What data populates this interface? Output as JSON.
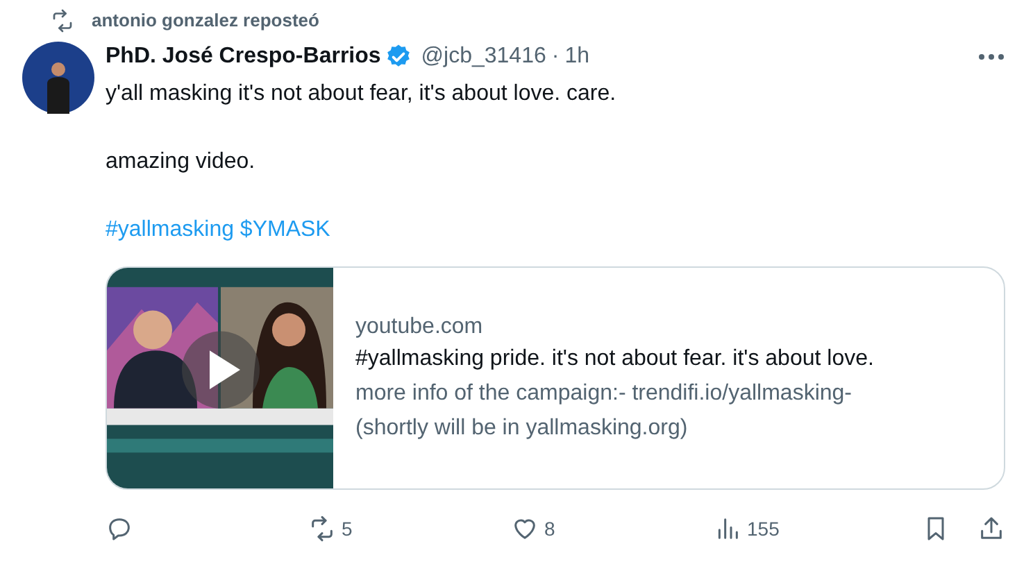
{
  "repost": {
    "label": "antonio gonzalez reposteó"
  },
  "author": {
    "name": "PhD. José Crespo-Barrios",
    "verified": true,
    "handle": "@jcb_31416",
    "separator": "·",
    "time": "1h"
  },
  "body": [
    {
      "kind": "text",
      "text": "y'all masking it's not about fear, it's about love. care."
    },
    {
      "kind": "text",
      "text": "amazing video."
    },
    {
      "kind": "tags",
      "text": "#yallmasking $YMASK"
    }
  ],
  "card": {
    "kind": "picture",
    "domain": "youtube.com",
    "title": "#yallmasking pride. it's not about fear. it's about love.",
    "description": "more info of the campaign:- trendifi.io/yallmasking-\n(shortly will be in yallmasking.org)"
  },
  "actions": [
    {
      "kind": "reply"
    },
    {
      "kind": "repost",
      "count": "5"
    },
    {
      "kind": "like",
      "count": "8"
    },
    {
      "kind": "views",
      "count": "155"
    }
  ],
  "end_actions": [
    {
      "kind": "bookmark"
    },
    {
      "kind": "share"
    }
  ]
}
